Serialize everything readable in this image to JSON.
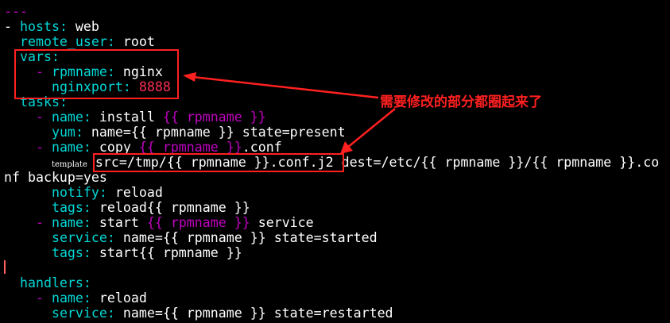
{
  "terminal": {
    "l00": {
      "dashes": "---"
    },
    "l01": {
      "dash": "- ",
      "key": "hosts",
      "sep": ": ",
      "val": "web"
    },
    "l02": {
      "key": "remote_user",
      "sep": ": ",
      "val": "root"
    },
    "l03": {
      "key": "vars",
      "sep": ":"
    },
    "l04": {
      "dash": "- ",
      "key": "rpmname",
      "sep": ": ",
      "val": "nginx"
    },
    "l05": {
      "key": "nginxport",
      "sep": ": ",
      "num": "8888"
    },
    "l06": {
      "key": "tasks",
      "sep": ":"
    },
    "l07": {
      "dash": "- ",
      "key": "name",
      "sep": ": ",
      "val": "install ",
      "jinja": "{{ rpmname }}"
    },
    "l08": {
      "key": "yum",
      "sep": ": ",
      "val": "name={{ rpmname }} state=present"
    },
    "l09": {
      "dash": "- ",
      "key": "name",
      "sep": ": ",
      "val": "copy ",
      "jinja": "{{ rpmname }}",
      "val2": ".conf"
    },
    "l10": {
      "tpl": "template",
      "src": "src=/tmp/{{ rpmname }}.conf.j2",
      "rest": " dest=/etc/{{ rpmname }}/{{ rpmname }}.co"
    },
    "l11": {
      "val": "nf backup=yes"
    },
    "l12": {
      "key": "notify",
      "sep": ": ",
      "val": "reload"
    },
    "l13": {
      "key": "tags",
      "sep": ": ",
      "val": "reload{{ rpmname }}"
    },
    "l14": {
      "dash": "- ",
      "key": "name",
      "sep": ": ",
      "val": "start ",
      "jinja": "{{ rpmname }}",
      "val2": " service"
    },
    "l15": {
      "key": "service",
      "sep": ": ",
      "val": "name={{ rpmname }} state=started"
    },
    "l16": {
      "key": "tags",
      "sep": ": ",
      "val": "start{{ rpmname }}"
    },
    "l18": {
      "key": "handlers",
      "sep": ":"
    },
    "l19": {
      "dash": "- ",
      "key": "name",
      "sep": ": ",
      "val": "reload"
    },
    "l20": {
      "key": "service",
      "sep": ": ",
      "val": "name={{ rpmname }} state=restarted"
    }
  },
  "annotation": {
    "text": "需要修改的部分都圈起来了",
    "color": "#ff2020"
  },
  "colors": {
    "key": "#00d7d7",
    "jinja": "#c000c0",
    "number": "#ff2d55",
    "background": "#000000"
  }
}
